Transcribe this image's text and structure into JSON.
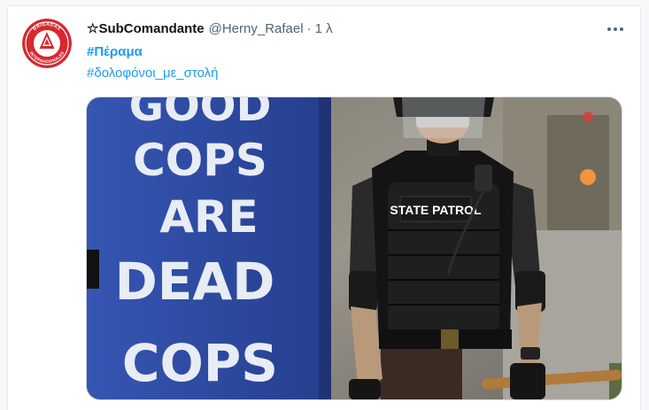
{
  "tweet": {
    "author": {
      "display_name": "☆SubComandante",
      "handle": "@Herny_Rafael",
      "avatar_text": "BRIGADAS INTERNACIONALES"
    },
    "separator": "·",
    "timestamp": "1 λ",
    "hashtags": [
      "#Πέραμα",
      "#δολοφόνοι_με_στολή"
    ],
    "more_icon": "more-horizontal-icon",
    "media": {
      "type": "photo",
      "sign_text": [
        "GOOD",
        "COPS",
        "ARE",
        "DEAD",
        "COPS"
      ],
      "vest_text": "STATE PATROL"
    }
  },
  "colors": {
    "link": "#1d9bf0",
    "secondary_text": "#536471",
    "avatar_red": "#d9272e",
    "sign_blue": "#2f4fa8"
  }
}
